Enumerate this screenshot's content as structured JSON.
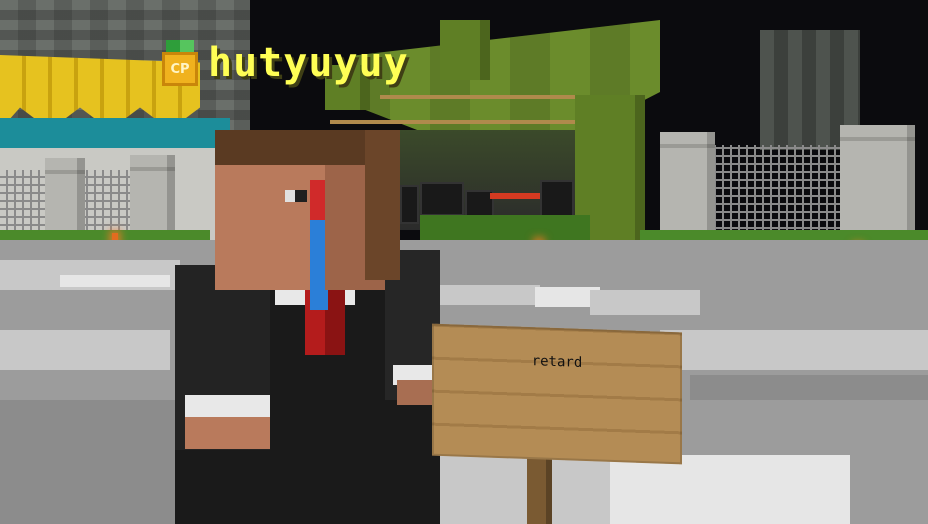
{
  "player": {
    "nametag": "hutyuyuy",
    "nametag_color": "#ffff55",
    "rank_badge_icon": "gold-medal-icon",
    "rank_badge_text": "CP"
  },
  "sign": {
    "line1": "retard",
    "line2": "",
    "line3": "",
    "line4": ""
  },
  "colors": {
    "grass": "#4b8a2a",
    "floor": "#9c9c9c",
    "sign_wood": "#b48c55"
  }
}
